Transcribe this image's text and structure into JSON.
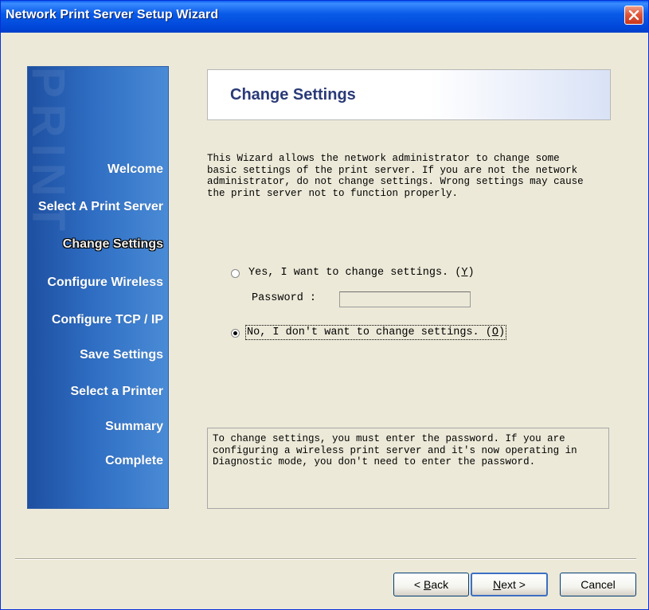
{
  "window": {
    "title": "Network Print Server Setup Wizard"
  },
  "sidebar": {
    "watermark": "PRINT",
    "items": [
      {
        "label": "Welcome"
      },
      {
        "label": "Select A Print Server"
      },
      {
        "label": "Change Settings"
      },
      {
        "label": "Configure Wireless"
      },
      {
        "label": "Configure TCP / IP"
      },
      {
        "label": "Save Settings"
      },
      {
        "label": "Select a Printer"
      },
      {
        "label": "Summary"
      },
      {
        "label": "Complete"
      }
    ],
    "active_index": 2
  },
  "header": {
    "title": "Change Settings"
  },
  "description": "This Wizard allows the network administrator to change some\nbasic settings of the print server. If you are not the network\nadministrator, do not change settings. Wrong settings may cause\nthe print server not to function properly.",
  "options": {
    "yes_label": "Yes, I want to change settings. (",
    "yes_key": "Y",
    "no_label": "No, I don't want to change settings. (",
    "no_key": "O",
    "selected": "no",
    "password_label": "Password :",
    "password_value": ""
  },
  "info": "To change settings, you must enter the password. If you are\nconfiguring a wireless print server and it's now operating in\nDiagnostic mode, you don't need to enter the password.",
  "buttons": {
    "back_prefix": "< ",
    "back_key": "B",
    "back_rest": "ack",
    "next_key": "N",
    "next_rest": "ext >",
    "cancel": "Cancel"
  }
}
